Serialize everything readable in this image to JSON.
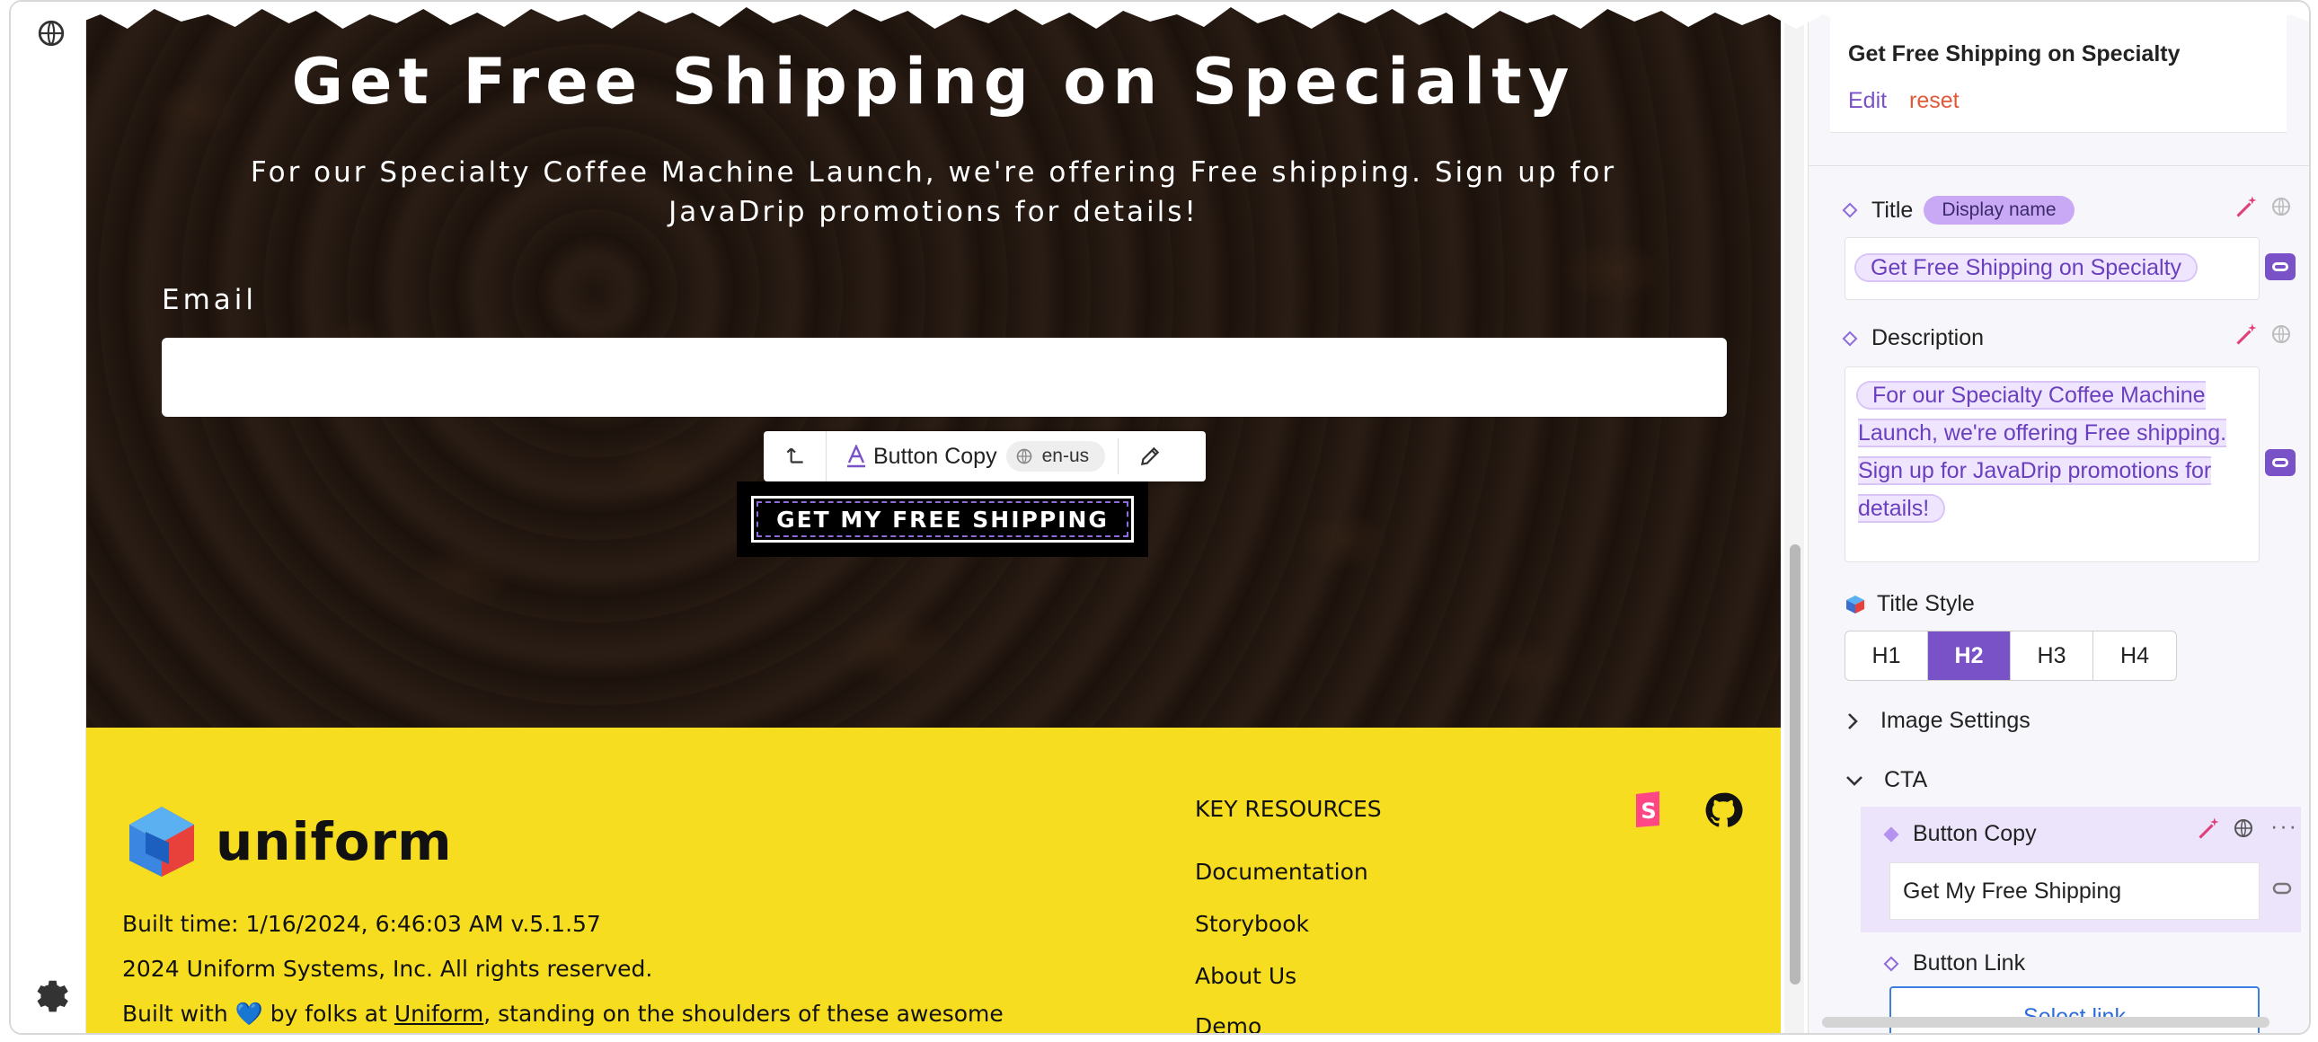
{
  "hero": {
    "title": "Get Free Shipping on Specialty",
    "description": "For our Specialty Coffee Machine Launch, we're offering Free shipping. Sign up for JavaDrip promotions for details!",
    "email_label": "Email",
    "email_value": "",
    "cta_label": "GET MY FREE SHIPPING"
  },
  "toolbar": {
    "component_label": "Button Copy",
    "locale": "en-us"
  },
  "footer": {
    "brand": "uniform",
    "built_time": "Built time: 1/16/2024, 6:46:03 AM v.5.1.57",
    "copyright": "2024 Uniform Systems, Inc. All rights reserved.",
    "built_with_prefix": "Built with 💙 by folks at ",
    "built_with_link": "Uniform",
    "built_with_suffix": ", standing on the shoulders of these awesome",
    "resources_title": "KEY RESOURCES",
    "resources": [
      "Documentation",
      "Storybook",
      "About Us",
      "Demo"
    ]
  },
  "panel": {
    "component_title": "Get Free Shipping on Specialty",
    "edit_label": "Edit",
    "reset_label": "reset",
    "title_field": {
      "label": "Title",
      "badge": "Display name",
      "value": "Get Free Shipping on Specialty"
    },
    "description_field": {
      "label": "Description",
      "value": "For our Specialty Coffee Machine Launch, we're offering Free shipping. Sign up for JavaDrip promotions for details!"
    },
    "title_style": {
      "label": "Title Style",
      "options": [
        "H1",
        "H2",
        "H3",
        "H4"
      ],
      "selected": "H2"
    },
    "image_settings_label": "Image Settings",
    "cta_label": "CTA",
    "button_copy": {
      "label": "Button Copy",
      "value": "Get My Free Shipping"
    },
    "button_link": {
      "label": "Button Link",
      "action": "Select link"
    }
  },
  "colors": {
    "accent": "#7a52c7",
    "footer_bg": "#f7dd1f",
    "reset": "#e05a3a"
  }
}
